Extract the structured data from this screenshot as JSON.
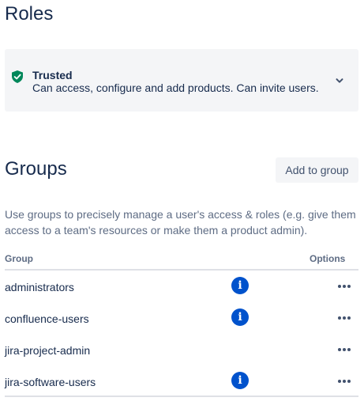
{
  "roles": {
    "title": "Roles",
    "card": {
      "name": "Trusted",
      "description": "Can access, configure and add products. Can invite users.",
      "icon": "shield-check-icon",
      "icon_color": "#00875A"
    }
  },
  "groups": {
    "title": "Groups",
    "add_button": "Add to group",
    "description": "Use groups to precisely manage a user's access & roles (e.g. give them access to a team's resources or make them a product admin).",
    "columns": {
      "group": "Group",
      "options": "Options"
    },
    "info_glyph": "i",
    "info_color": "#0052CC",
    "rows": [
      {
        "name": "administrators",
        "has_info": true
      },
      {
        "name": "confluence-users",
        "has_info": true
      },
      {
        "name": "jira-project-admin",
        "has_info": false
      },
      {
        "name": "jira-software-users",
        "has_info": true
      }
    ]
  }
}
